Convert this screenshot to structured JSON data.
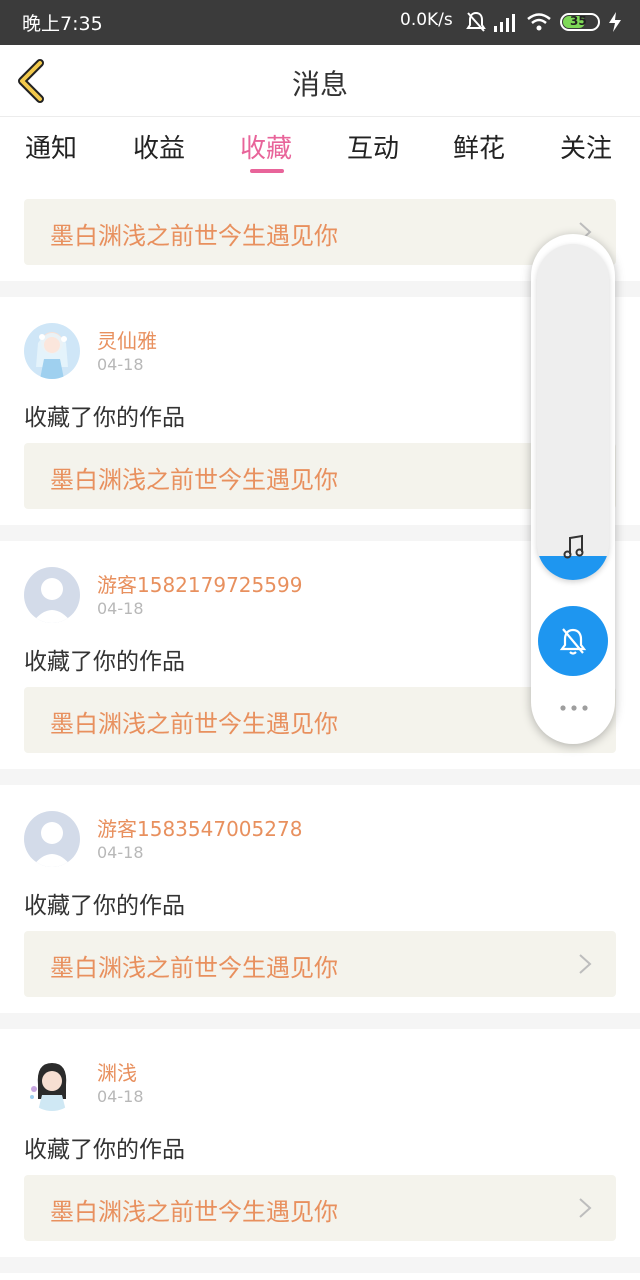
{
  "status_bar": {
    "time": "晚上7:35",
    "network_speed": "0.0K/s",
    "battery": "35"
  },
  "header": {
    "title": "消息"
  },
  "tabs": [
    {
      "label": "通知",
      "active": false
    },
    {
      "label": "收益",
      "active": false
    },
    {
      "label": "收藏",
      "active": true
    },
    {
      "label": "互动",
      "active": false
    },
    {
      "label": "鲜花",
      "active": false
    },
    {
      "label": "关注",
      "active": false
    }
  ],
  "top_work": {
    "title": "墨白渊浅之前世今生遇见你"
  },
  "items": [
    {
      "username": "灵仙雅",
      "date": "04-18",
      "action": "收藏了你的作品",
      "work_title": "墨白渊浅之前世今生遇见你"
    },
    {
      "username": "游客1582179725599",
      "date": "04-18",
      "action": "收藏了你的作品",
      "work_title": "墨白渊浅之前世今生遇见你"
    },
    {
      "username": "游客1583547005278",
      "date": "04-18",
      "action": "收藏了你的作品",
      "work_title": "墨白渊浅之前世今生遇见你"
    },
    {
      "username": "渊浅",
      "date": "04-18",
      "action": "收藏了你的作品",
      "work_title": "墨白渊浅之前世今生遇见你"
    }
  ],
  "floating_player": {
    "volume_level": 0.07
  },
  "colors": {
    "accent": "#e8649a",
    "link_text": "#e8905e",
    "player_blue": "#1e96f0"
  },
  "icons": [
    "back-icon",
    "chevron-right-icon",
    "music-note-icon",
    "bell-off-icon",
    "more-dots-icon",
    "default-avatar-icon"
  ]
}
